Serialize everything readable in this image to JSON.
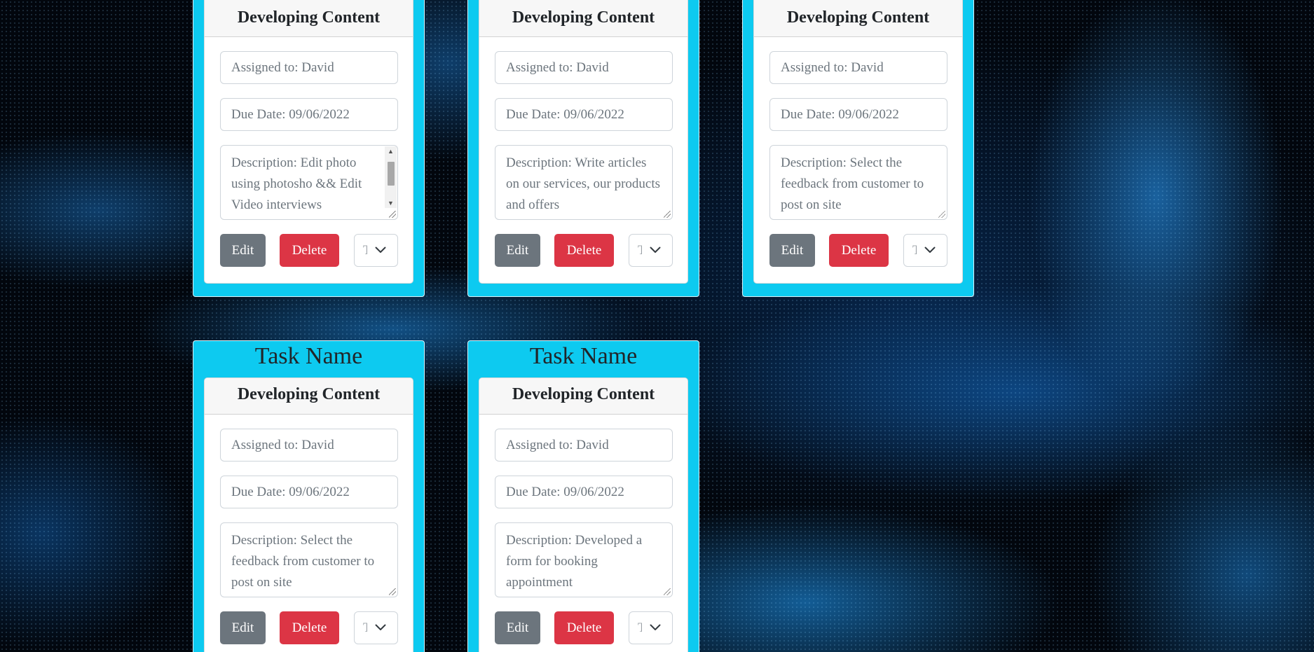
{
  "tasks": [
    {
      "card_title": "Developing Content",
      "assigned": "Assigned to: David",
      "due": "Due Date: 09/06/2022",
      "description": "Description: Edit photo using photosho &&  Edit Video interviews",
      "status": "Todo",
      "edit_label": "Edit",
      "delete_label": "Delete"
    },
    {
      "card_title": "Developing Content",
      "assigned": "Assigned to: David",
      "due": "Due Date: 09/06/2022",
      "description": "Description: Write articles on our services, our products and offers",
      "status": "Todo",
      "edit_label": "Edit",
      "delete_label": "Delete"
    },
    {
      "card_title": "Developing Content",
      "assigned": "Assigned to: David",
      "due": "Due Date: 09/06/2022",
      "description": "Description: Select the feedback from customer to post on site",
      "status": "Todo",
      "edit_label": "Edit",
      "delete_label": "Delete"
    },
    {
      "heading": "Task Name",
      "card_title": "Developing Content",
      "assigned": "Assigned to: David",
      "due": "Due Date: 09/06/2022",
      "description": "Description: Select the feedback from customer to post on site",
      "status": "Todo",
      "edit_label": "Edit",
      "delete_label": "Delete"
    },
    {
      "heading": "Task Name",
      "card_title": "Developing Content",
      "assigned": "Assigned to: David",
      "due": "Due Date: 09/06/2022",
      "description": "Description: Developed a form for booking appointment",
      "status": "Todo",
      "edit_label": "Edit",
      "delete_label": "Delete"
    }
  ],
  "icons": {
    "status_dropdown": "chevron-down-icon",
    "textarea_corner": "resize-grip-icon"
  },
  "colors": {
    "task_panel": "#0dcaf0",
    "edit_button": "#6c757d",
    "delete_button": "#dc3545"
  }
}
